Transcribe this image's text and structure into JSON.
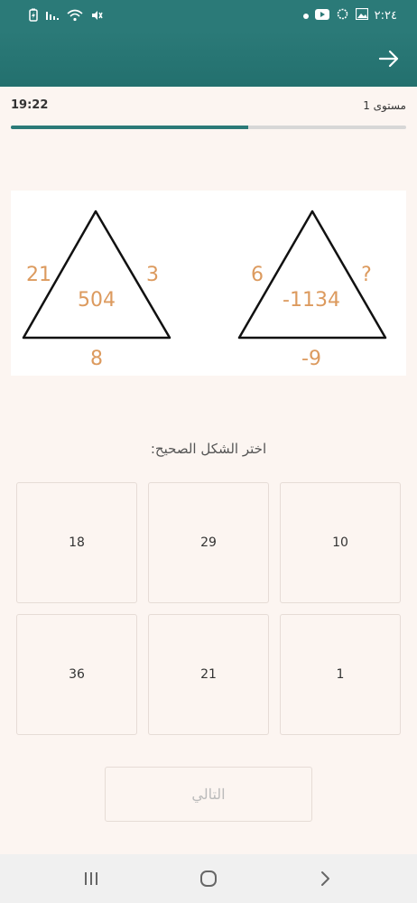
{
  "statusbar": {
    "time": "٢:٢٤"
  },
  "header": {
    "level": "مستوى 1",
    "timer": "19:22",
    "progress": 0.6
  },
  "puzzle": {
    "left_triangle": {
      "left": "21",
      "right": "3",
      "center": "504",
      "bottom": "8"
    },
    "right_triangle": {
      "left": "6",
      "right": "?",
      "center": "-1134",
      "bottom": "-9"
    },
    "number_color": "#dc9a5e"
  },
  "prompt": "اختر الشكل الصحيح:",
  "options": [
    {
      "value": "18"
    },
    {
      "value": "29"
    },
    {
      "value": "10"
    },
    {
      "value": "36"
    },
    {
      "value": "21"
    },
    {
      "value": "1"
    }
  ],
  "next_button": {
    "label": "التالي"
  },
  "colors": {
    "primary": "#2b7a78",
    "background": "#fcf5f1",
    "accent": "#dc9a5e"
  }
}
